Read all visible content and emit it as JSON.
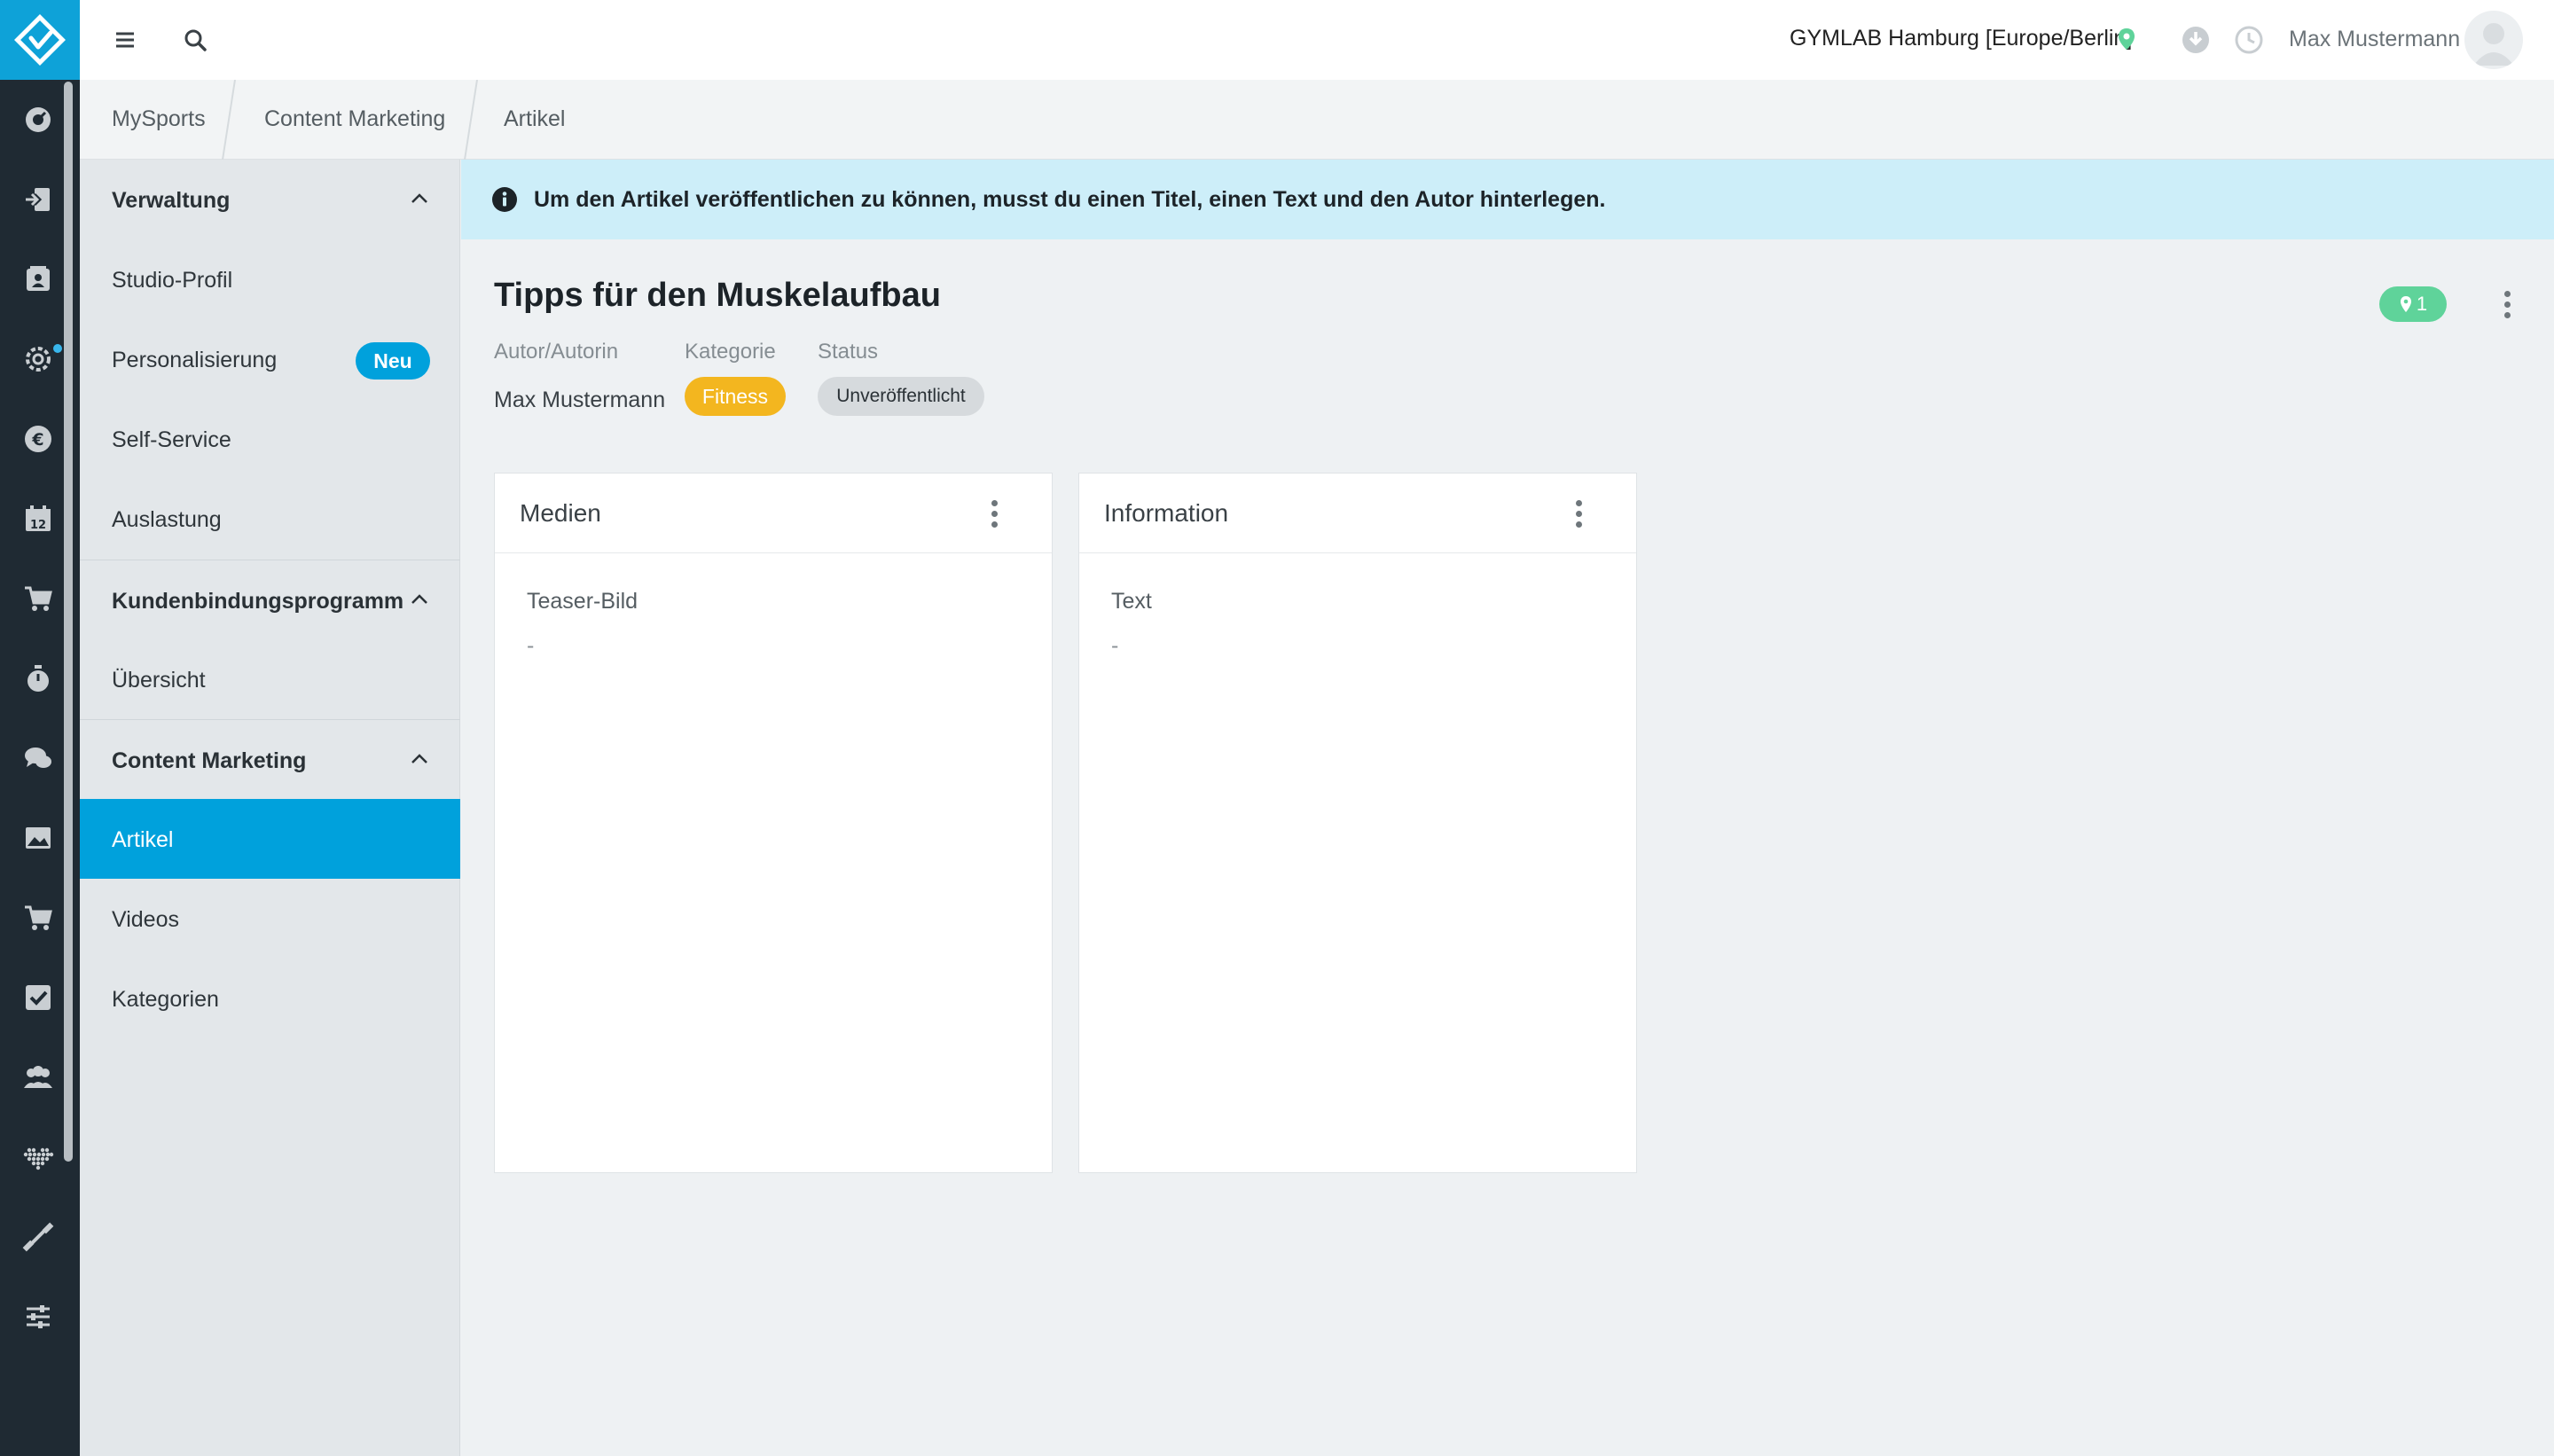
{
  "topbar": {
    "location": "GYMLAB Hamburg [Europe/Berlin]",
    "user_name": "Max Mustermann"
  },
  "breadcrumb": [
    "MySports",
    "Content Marketing",
    "Artikel"
  ],
  "sidebar": {
    "groups": [
      {
        "label": "Verwaltung",
        "items": [
          {
            "label": "Studio-Profil"
          },
          {
            "label": "Personalisierung",
            "badge": "Neu"
          },
          {
            "label": "Self-Service"
          },
          {
            "label": "Auslastung"
          }
        ]
      },
      {
        "label": "Kundenbindungsprogramm",
        "items": [
          {
            "label": "Übersicht"
          }
        ]
      },
      {
        "label": "Content Marketing",
        "items": [
          {
            "label": "Artikel",
            "active": true
          },
          {
            "label": "Videos"
          },
          {
            "label": "Kategorien"
          }
        ]
      }
    ]
  },
  "alert": {
    "text": "Um den Artikel veröffentlichen zu können, musst du einen Titel, einen Text und den Autor hinterlegen."
  },
  "article": {
    "title": "Tipps für den Muskelaufbau",
    "author_label": "Autor/Autorin",
    "author": "Max Mustermann",
    "category_label": "Kategorie",
    "category": "Fitness",
    "status_label": "Status",
    "status": "Unveröffentlicht",
    "location_count": "1"
  },
  "cards": [
    {
      "title": "Medien",
      "field_label": "Teaser-Bild",
      "field_value": "-"
    },
    {
      "title": "Information",
      "field_label": "Text",
      "field_value": "-"
    }
  ],
  "colors": {
    "rail": "#1f2a33",
    "accent": "#00a1dc",
    "alert_bg": "#cdeef9",
    "category": "#f3b61f",
    "location_badge": "#5fd39a"
  }
}
